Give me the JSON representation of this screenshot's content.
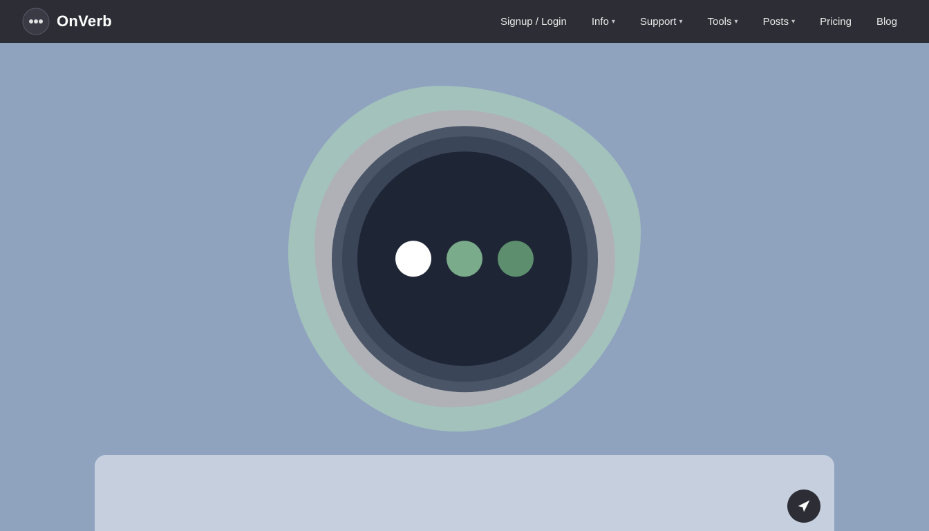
{
  "navbar": {
    "logo_text": "OnVerb",
    "nav_items": [
      {
        "id": "signup-login",
        "label": "Signup / Login",
        "has_dropdown": false
      },
      {
        "id": "info",
        "label": "Info",
        "has_dropdown": true
      },
      {
        "id": "support",
        "label": "Support",
        "has_dropdown": true
      },
      {
        "id": "tools",
        "label": "Tools",
        "has_dropdown": true
      },
      {
        "id": "posts",
        "label": "Posts",
        "has_dropdown": true
      },
      {
        "id": "pricing",
        "label": "Pricing",
        "has_dropdown": false
      },
      {
        "id": "blog",
        "label": "Blog",
        "has_dropdown": false
      }
    ]
  },
  "main": {
    "background_color": "#8fa3bf",
    "orb": {
      "dots": [
        {
          "id": "dot-white",
          "color": "#ffffff"
        },
        {
          "id": "dot-green-light",
          "color": "#7aab8a"
        },
        {
          "id": "dot-green-dark",
          "color": "#5d8f6e"
        }
      ]
    }
  },
  "icons": {
    "logo": "💬",
    "chevron": "▾",
    "send": "→"
  }
}
